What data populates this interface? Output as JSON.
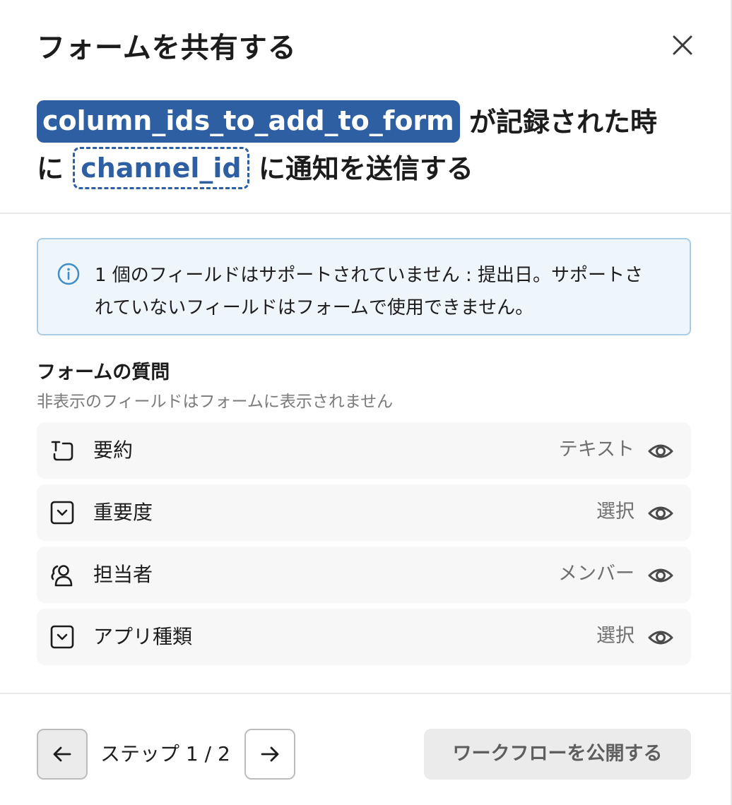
{
  "dialog": {
    "title": "フォームを共有する",
    "summary": {
      "token_column": "column_ids_to_add_to_form",
      "text_after_column": "が記録された時",
      "text_prefix_line2": "に",
      "token_channel": "channel_id",
      "text_after_channel": "に通知を送信する"
    },
    "info": {
      "message": "1 個のフィールドはサポートされていません : 提出日。サポートされていないフィールドはフォームで使用できません。"
    },
    "questions": {
      "title": "フォームの質問",
      "subtitle": "非表示のフィールドはフォームに表示されません",
      "fields": [
        {
          "label": "要約",
          "type": "テキスト",
          "icon": "text-field-icon"
        },
        {
          "label": "重要度",
          "type": "選択",
          "icon": "dropdown-icon"
        },
        {
          "label": "担当者",
          "type": "メンバー",
          "icon": "member-icon"
        },
        {
          "label": "アプリ種類",
          "type": "選択",
          "icon": "dropdown-icon"
        }
      ]
    },
    "footer": {
      "step_text": "ステップ 1 / 2",
      "publish_label": "ワークフローを公開する"
    }
  },
  "colors": {
    "accent": "#2f5fa3",
    "info_bg": "#eef5fb",
    "info_border": "#a9cde6",
    "row_bg": "#f7f7f7"
  }
}
